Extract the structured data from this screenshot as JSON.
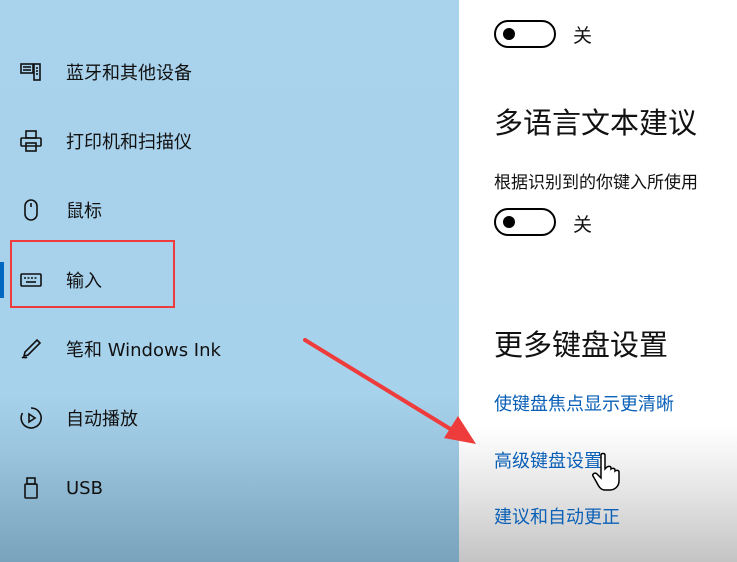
{
  "sidebar": {
    "items": [
      {
        "label": "蓝牙和其他设备",
        "icon": "bluetooth-devices-icon"
      },
      {
        "label": "打印机和扫描仪",
        "icon": "printer-icon"
      },
      {
        "label": "鼠标",
        "icon": "mouse-icon"
      },
      {
        "label": "输入",
        "icon": "keyboard-icon",
        "selected": true
      },
      {
        "label": "笔和 Windows Ink",
        "icon": "pen-icon"
      },
      {
        "label": "自动播放",
        "icon": "autoplay-icon"
      },
      {
        "label": "USB",
        "icon": "usb-icon"
      }
    ]
  },
  "main": {
    "toggle_1": {
      "state_label": "关",
      "on": false
    },
    "multilingual": {
      "heading": "多语言文本建议",
      "description": "根据识别到的你键入所使用",
      "toggle": {
        "state_label": "关",
        "on": false
      }
    },
    "more_keyboard": {
      "heading": "更多键盘设置",
      "links": [
        "使键盘焦点显示更清晰",
        "高级键盘设置",
        "建议和自动更正"
      ]
    }
  },
  "colors": {
    "sidebar_bg": "#a9d2ec",
    "accent": "#0067c0",
    "link": "#0a5fb6",
    "annotation_red": "#ee3b3b"
  }
}
